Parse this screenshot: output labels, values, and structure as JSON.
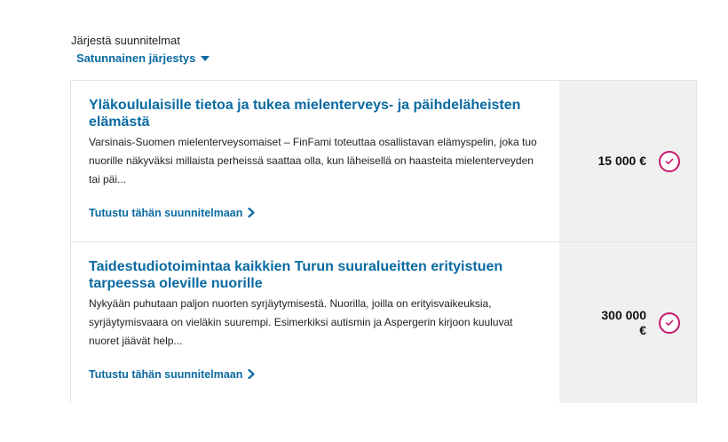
{
  "sort": {
    "label": "Järjestä suunnitelmat",
    "selected": "Satunnainen järjestys"
  },
  "colors": {
    "link": "#0a6aa1",
    "accent": "#c8176a",
    "side_panel": "#f0f0f0"
  },
  "plans": [
    {
      "title": "Yläkoululaisille tietoa ja tukea mielenterveys- ja päihdeläheisten elämästä",
      "description": "Varsinais-Suomen mielenterveysomaiset – FinFami toteuttaa osallistavan elämyspelin, joka tuo nuorille näkyväksi millaista perheissä saattaa olla, kun läheisellä on haasteita mielenterveyden tai päi...",
      "link": "Tutustu tähän suunnitelmaan",
      "amount": "15 000 €",
      "icon": "check-circle-icon"
    },
    {
      "title": "Taidestudiotoimintaa kaikkien Turun suuralueitten erityistuen tarpeessa oleville nuorille",
      "description": "Nykyään puhutaan paljon nuorten syrjäytymisestä. Nuorilla, joilla on erityisvaikeuksia, syrjäytymisvaara on vieläkin suurempi. Esimerkiksi autismin ja Aspergerin kirjoon kuuluvat nuoret jäävät help...",
      "link": "Tutustu tähän suunnitelmaan",
      "amount": "300 000 €",
      "icon": "check-circle-icon"
    }
  ]
}
